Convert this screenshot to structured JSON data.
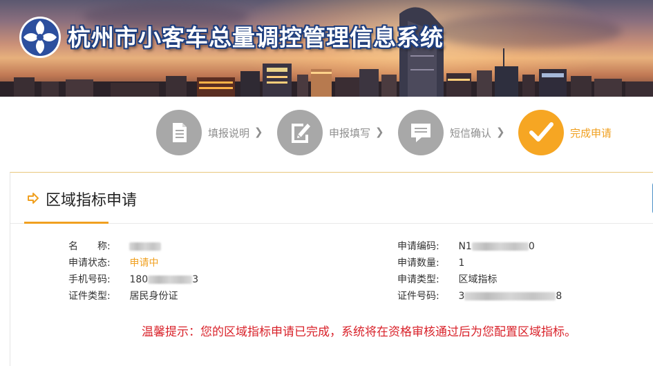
{
  "header": {
    "site_title": "杭州市小客车总量调控管理信息系统",
    "logo_icon": "hangzhou-emblem-icon"
  },
  "steps": [
    {
      "label": "填报说明",
      "icon": "document-icon",
      "active": false
    },
    {
      "label": "申报填写",
      "icon": "edit-icon",
      "active": false
    },
    {
      "label": "短信确认",
      "icon": "message-icon",
      "active": false
    },
    {
      "label": "完成申请",
      "icon": "check-icon",
      "active": true
    }
  ],
  "step_arrow": "❯",
  "panel": {
    "title": "区域指标申请",
    "left_rows": [
      {
        "key": "名　　称:",
        "value": ""
      },
      {
        "key": "申请状态:",
        "value": "申请中"
      },
      {
        "key": "手机号码:",
        "value_prefix": "180",
        "value_suffix": "3"
      },
      {
        "key": "证件类型:",
        "value": "居民身份证"
      }
    ],
    "right_rows": [
      {
        "key": "申请编码:",
        "value_prefix": "N1",
        "value_suffix": "0"
      },
      {
        "key": "申请数量:",
        "value": "1"
      },
      {
        "key": "申请类型:",
        "value": "区域指标"
      },
      {
        "key": "证件号码:",
        "value_prefix": "3",
        "value_suffix": "8"
      }
    ],
    "notice": "温馨提示：您的区域指标申请已完成，系统将在资格审核通过后为您配置区域指标。"
  },
  "colors": {
    "accent": "#f0a020",
    "notice": "#d9222a",
    "step_gray": "#a8a8a8",
    "title_outline": "#1f3f7f"
  }
}
